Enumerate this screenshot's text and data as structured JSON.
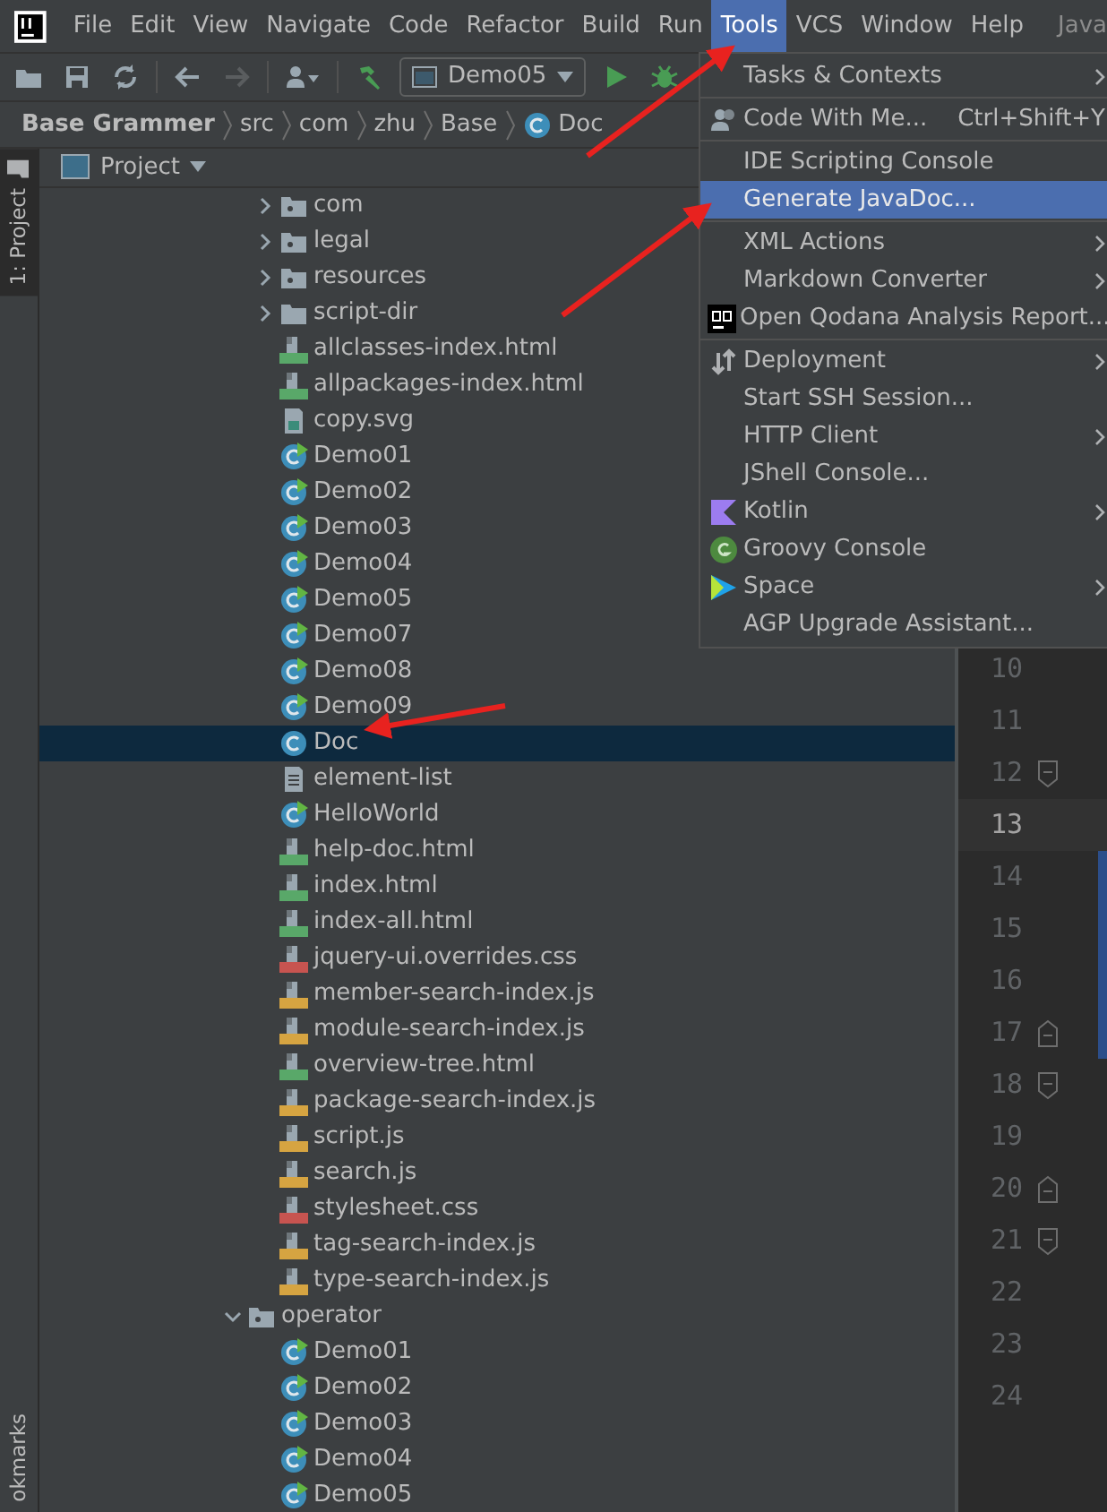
{
  "menubar": {
    "items": [
      {
        "label": "File",
        "selected": false
      },
      {
        "label": "Edit",
        "selected": false
      },
      {
        "label": "View",
        "selected": false
      },
      {
        "label": "Navigate",
        "selected": false
      },
      {
        "label": "Code",
        "selected": false
      },
      {
        "label": "Refactor",
        "selected": false
      },
      {
        "label": "Build",
        "selected": false
      },
      {
        "label": "Run",
        "selected": false
      },
      {
        "label": "Tools",
        "selected": true
      },
      {
        "label": "VCS",
        "selected": false
      },
      {
        "label": "Window",
        "selected": false
      },
      {
        "label": "Help",
        "selected": false
      }
    ],
    "window_title": "Java"
  },
  "toolbar": {
    "run_configuration": "Demo05"
  },
  "breadcrumb": [
    {
      "label": "Base Grammer",
      "kind": "project"
    },
    {
      "label": "src",
      "kind": "folder"
    },
    {
      "label": "com",
      "kind": "folder"
    },
    {
      "label": "zhu",
      "kind": "folder"
    },
    {
      "label": "Base",
      "kind": "folder"
    },
    {
      "label": "Doc",
      "kind": "class"
    }
  ],
  "side_tabs": [
    {
      "label": "1: Project",
      "selected": true
    },
    {
      "label": "okmarks",
      "selected": false
    }
  ],
  "project_panel": {
    "title": "Project",
    "tree": [
      {
        "children": [
          {
            "label": "com",
            "kind": "package",
            "expanded": false
          },
          {
            "label": "legal",
            "kind": "package",
            "expanded": false
          },
          {
            "label": "resources",
            "kind": "package",
            "expanded": false
          },
          {
            "label": "script-dir",
            "kind": "folder",
            "expanded": false
          },
          {
            "label": "allclasses-index.html",
            "kind": "html",
            "selected": false
          },
          {
            "label": "allpackages-index.html",
            "kind": "html",
            "selected": false
          },
          {
            "label": "copy.svg",
            "kind": "svg",
            "selected": false
          },
          {
            "label": "Demo01",
            "kind": "runnable-class",
            "selected": false
          },
          {
            "label": "Demo02",
            "kind": "runnable-class",
            "selected": false
          },
          {
            "label": "Demo03",
            "kind": "runnable-class",
            "selected": false
          },
          {
            "label": "Demo04",
            "kind": "runnable-class",
            "selected": false
          },
          {
            "label": "Demo05",
            "kind": "runnable-class",
            "selected": false
          },
          {
            "label": "Demo07",
            "kind": "runnable-class",
            "selected": false
          },
          {
            "label": "Demo08",
            "kind": "runnable-class",
            "selected": false
          },
          {
            "label": "Demo09",
            "kind": "runnable-class",
            "selected": false
          },
          {
            "label": "Doc",
            "kind": "class",
            "selected": true
          },
          {
            "label": "element-list",
            "kind": "text",
            "selected": false
          },
          {
            "label": "HelloWorld",
            "kind": "runnable-class",
            "selected": false
          },
          {
            "label": "help-doc.html",
            "kind": "html",
            "selected": false
          },
          {
            "label": "index.html",
            "kind": "html",
            "selected": false
          },
          {
            "label": "index-all.html",
            "kind": "html",
            "selected": false
          },
          {
            "label": "jquery-ui.overrides.css",
            "kind": "css",
            "selected": false
          },
          {
            "label": "member-search-index.js",
            "kind": "js",
            "selected": false
          },
          {
            "label": "module-search-index.js",
            "kind": "js",
            "selected": false
          },
          {
            "label": "overview-tree.html",
            "kind": "html",
            "selected": false
          },
          {
            "label": "package-search-index.js",
            "kind": "js",
            "selected": false
          },
          {
            "label": "script.js",
            "kind": "js",
            "selected": false
          },
          {
            "label": "search.js",
            "kind": "js",
            "selected": false
          },
          {
            "label": "stylesheet.css",
            "kind": "css",
            "selected": false
          },
          {
            "label": "tag-search-index.js",
            "kind": "js",
            "selected": false
          },
          {
            "label": "type-search-index.js",
            "kind": "js",
            "selected": false
          }
        ]
      },
      {
        "label": "operator",
        "kind": "package",
        "expanded": true,
        "children": [
          {
            "label": "Demo01",
            "kind": "runnable-class",
            "selected": false
          },
          {
            "label": "Demo02",
            "kind": "runnable-class",
            "selected": false
          },
          {
            "label": "Demo03",
            "kind": "runnable-class",
            "selected": false
          },
          {
            "label": "Demo04",
            "kind": "runnable-class",
            "selected": false
          },
          {
            "label": "Demo05",
            "kind": "runnable-class",
            "selected": false
          }
        ]
      }
    ]
  },
  "editor": {
    "lines": [
      {
        "number": "10",
        "current": false,
        "changed": false
      },
      {
        "number": "11",
        "current": false,
        "changed": false
      },
      {
        "number": "12",
        "current": false,
        "changed": false
      },
      {
        "number": "13",
        "current": true,
        "changed": false
      },
      {
        "number": "14",
        "current": false,
        "changed": true
      },
      {
        "number": "15",
        "current": false,
        "changed": true
      },
      {
        "number": "16",
        "current": false,
        "changed": true
      },
      {
        "number": "17",
        "current": false,
        "changed": true
      },
      {
        "number": "18",
        "current": false,
        "changed": false
      },
      {
        "number": "19",
        "current": false,
        "changed": false
      },
      {
        "number": "20",
        "current": false,
        "changed": false
      },
      {
        "number": "21",
        "current": false,
        "changed": false
      },
      {
        "number": "22",
        "current": false,
        "changed": false
      },
      {
        "number": "23",
        "current": false,
        "changed": false
      },
      {
        "number": "24",
        "current": false,
        "changed": false
      }
    ]
  },
  "tools_menu": {
    "items": [
      {
        "kind": "item",
        "label": "Tasks & Contexts",
        "submenu": true,
        "selected": false
      },
      {
        "kind": "separator"
      },
      {
        "kind": "item",
        "label": "Code With Me...",
        "shortcut": "Ctrl+Shift+Y",
        "selected": false
      },
      {
        "kind": "separator"
      },
      {
        "kind": "item",
        "label": "IDE Scripting Console",
        "selected": false
      },
      {
        "kind": "item",
        "label": "Generate JavaDoc...",
        "selected": true
      },
      {
        "kind": "separator"
      },
      {
        "kind": "item",
        "label": "XML Actions",
        "submenu": true,
        "selected": false
      },
      {
        "kind": "item",
        "label": "Markdown Converter",
        "submenu": true,
        "selected": false
      },
      {
        "kind": "item",
        "label": "Open Qodana Analysis Report...",
        "selected": false
      },
      {
        "kind": "separator"
      },
      {
        "kind": "item",
        "label": "Deployment",
        "submenu": true,
        "selected": false
      },
      {
        "kind": "item",
        "label": "Start SSH Session...",
        "selected": false
      },
      {
        "kind": "item",
        "label": "HTTP Client",
        "submenu": true,
        "selected": false
      },
      {
        "kind": "item",
        "label": "JShell Console...",
        "selected": false
      },
      {
        "kind": "item",
        "label": "Kotlin",
        "submenu": true,
        "selected": false
      },
      {
        "kind": "item",
        "label": "Groovy Console",
        "selected": false
      },
      {
        "kind": "item",
        "label": "Space",
        "submenu": true,
        "selected": false
      },
      {
        "kind": "item",
        "label": "AGP Upgrade Assistant...",
        "selected": false
      }
    ]
  }
}
